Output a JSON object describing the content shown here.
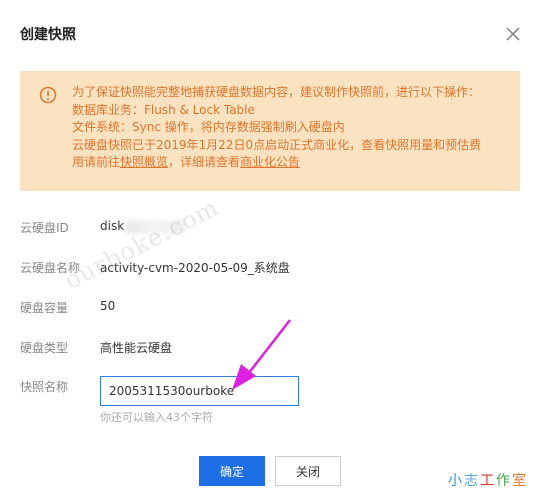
{
  "dialog": {
    "title": "创建快照",
    "notice": {
      "line1": "为了保证快照能完整地捕获硬盘数据内容，建议制作快照前，进行以下操作：",
      "line2": "数据库业务：Flush & Lock Table",
      "line3": "文件系统：Sync 操作，将内存数据强制刷入硬盘内",
      "line4": "云硬盘快照已于2019年1月22日0点启动正式商业化，查看快照用量和预估费",
      "line5_prefix": "用请前往",
      "line5_link1": "快照概览",
      "line5_middle": "，详细请查看",
      "line5_link2": "商业化公告"
    },
    "fields": {
      "disk_id_label": "云硬盘ID",
      "disk_id_value": "disk",
      "disk_name_label": "云硬盘名称",
      "disk_name_value": "activity-cvm-2020-05-09_系统盘",
      "disk_capacity_label": "硬盘容量",
      "disk_capacity_value": "50",
      "disk_type_label": "硬盘类型",
      "disk_type_value": "高性能云硬盘",
      "snapshot_name_label": "快照名称",
      "snapshot_name_value": "2005311530ourboke",
      "snapshot_name_hint": "你还可以输入43个字符"
    },
    "buttons": {
      "confirm": "确定",
      "close": "关闭"
    }
  },
  "watermarks": {
    "diagonal": "ourboke.com",
    "corner": "小志工作室"
  },
  "colors": {
    "primary": "#1e6fe6",
    "notice_bg": "#fbe3c1",
    "notice_text": "#e0752b",
    "arrow": "#e020e0"
  },
  "icons": {
    "close": "close-icon",
    "notice": "warning-icon",
    "arrow": "pointer-arrow"
  }
}
